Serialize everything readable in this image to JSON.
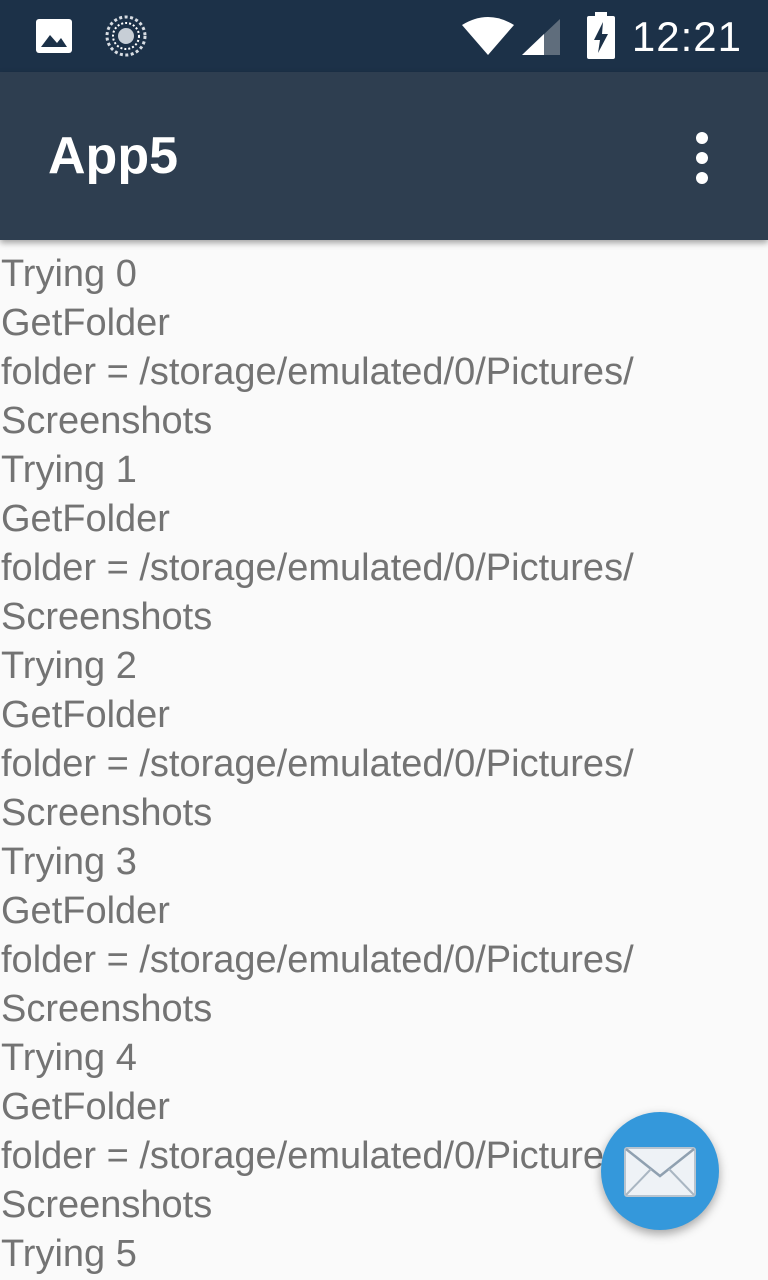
{
  "status_bar": {
    "time": "12:21",
    "icons": [
      "image-notification-icon",
      "sync-progress-icon",
      "wifi-icon",
      "cell-signal-icon",
      "battery-charging-icon"
    ],
    "background_color": "#1c3148"
  },
  "app_bar": {
    "title": "App5",
    "overflow_icon": "more-vert-icon",
    "background_color": "#2e3e50"
  },
  "log": {
    "lines": [
      "Trying 0",
      "GetFolder",
      "folder = /storage/emulated/0/Pictures/",
      "Screenshots",
      "Trying 1",
      "GetFolder",
      "folder = /storage/emulated/0/Pictures/",
      "Screenshots",
      "Trying 2",
      "GetFolder",
      "folder = /storage/emulated/0/Pictures/",
      "Screenshots",
      "Trying 3",
      "GetFolder",
      "folder = /storage/emulated/0/Pictures/",
      "Screenshots",
      "Trying 4",
      "GetFolder",
      "folder = /storage/emulated/0/Pictures/",
      "Screenshots",
      "Trying 5"
    ],
    "text_color": "#737373"
  },
  "fab": {
    "icon": "envelope-icon",
    "background_color": "#3498db"
  }
}
